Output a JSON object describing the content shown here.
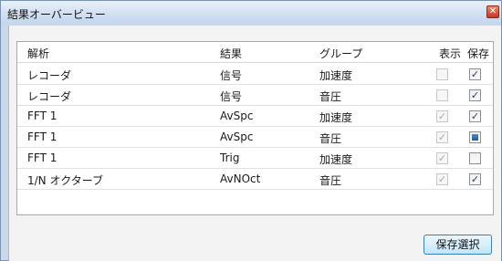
{
  "window": {
    "title": "結果オーバービュー",
    "close_glyph": "✕"
  },
  "table": {
    "columns": [
      "解析",
      "結果",
      "グループ",
      "表示",
      "保存"
    ],
    "rows": [
      {
        "analysis": "レコーダ",
        "result": "信号",
        "group": "加速度",
        "show": "unchecked-disabled",
        "save": "checked"
      },
      {
        "analysis": "レコーダ",
        "result": "信号",
        "group": "音圧",
        "show": "unchecked-disabled",
        "save": "checked"
      },
      {
        "analysis": "FFT 1",
        "result": "AvSpc",
        "group": "加速度",
        "show": "checked-disabled",
        "save": "checked"
      },
      {
        "analysis": "FFT 1",
        "result": "AvSpc",
        "group": "音圧",
        "show": "checked-disabled",
        "save": "indeterminate"
      },
      {
        "analysis": "FFT 1",
        "result": "Trig",
        "group": "加速度",
        "show": "checked-disabled",
        "save": "unchecked"
      },
      {
        "analysis": "1/N オクターブ",
        "result": "AvNOct",
        "group": "音圧",
        "show": "checked-disabled",
        "save": "checked"
      }
    ]
  },
  "buttons": {
    "save_selection": "保存選択"
  },
  "icons": {
    "check": "check-icon",
    "close": "close-icon"
  },
  "colors": {
    "accent": "#3c7fb1",
    "titlebar": "#d3e1f2"
  }
}
